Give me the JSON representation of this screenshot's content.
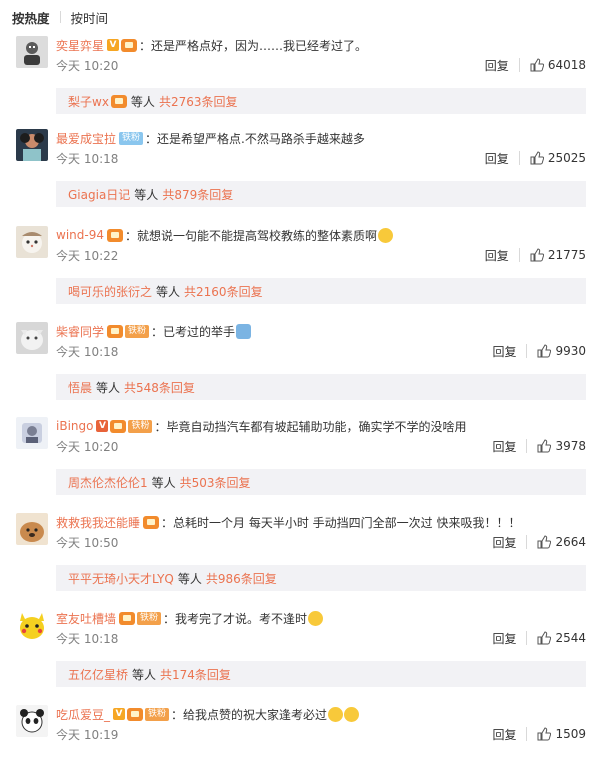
{
  "sort": {
    "hot_label": "按热度",
    "time_label": "按时间"
  },
  "labels": {
    "reply": "回复",
    "etc": "等人",
    "fan_tag": "铁粉"
  },
  "colors": {
    "username": "#eb7350",
    "subreply_bg": "#f2f2f5",
    "vip_gold": "#f6a623"
  },
  "comments": [
    {
      "user": "奕星弈星",
      "badges": [
        "v",
        "crown"
      ],
      "text": "：还是严格点好，因为……我已经考过了。",
      "time": "今天 10:20",
      "likes": "64018",
      "sub_name": "梨子wx",
      "sub_total": "共2763条回复"
    },
    {
      "user": "最爱成宝拉",
      "badges": [
        "fan-blue"
      ],
      "text": "：还是希望严格点.不然马路杀手越来越多",
      "time": "今天 10:18",
      "likes": "25025",
      "sub_name": "Giagia日记",
      "sub_total": "共879条回复"
    },
    {
      "user": "wind-94",
      "badges": [
        "crown"
      ],
      "text": "：就想说一句能不能提高驾校教练的整体素质啊",
      "emoji": [
        "crying-emoji"
      ],
      "time": "今天 10:22",
      "likes": "21775",
      "sub_name": "喝可乐的张衍之",
      "sub_total": "共2160条回复"
    },
    {
      "user": "柴睿同学",
      "badges": [
        "crown",
        "fan-orange"
      ],
      "text": "：已考过的举手",
      "emoji": [
        "raise-hand-emoji"
      ],
      "time": "今天 10:18",
      "likes": "9930",
      "sub_name": "悟晨",
      "sub_total": "共548条回复"
    },
    {
      "user": "iBingo",
      "badges": [
        "v",
        "crown",
        "fan-orange"
      ],
      "text": "：毕竟自动挡汽车都有坡起辅助功能，确实学不学的没啥用",
      "time": "今天 10:20",
      "likes": "3978",
      "sub_name": "周杰伦杰伦伦1",
      "sub_total": "共503条回复"
    },
    {
      "user": "救救我我还能睡",
      "badges": [
        "crown"
      ],
      "text": "：总耗时一个月   每天半小时   手动挡四门全部一次过   快来吸我！！！",
      "time": "今天 10:50",
      "likes": "2664",
      "sub_name": "平平无琦小天才LYQ",
      "sub_total": "共986条回复"
    },
    {
      "user": "室友吐槽墙",
      "badges": [
        "crown",
        "fan-orange"
      ],
      "text": "：我考完了才说。考不逢时",
      "emoji": [
        "laugh-emoji"
      ],
      "time": "今天 10:18",
      "likes": "2544",
      "sub_name": "五亿亿星桥",
      "sub_total": "共174条回复"
    },
    {
      "user": "吃瓜爱豆_",
      "badges": [
        "v",
        "crown",
        "fan-orange"
      ],
      "text": "：给我点赞的祝大家逢考必过",
      "emoji": [
        "kiss-emoji",
        "kiss-emoji"
      ],
      "time": "今天 10:19",
      "likes": "1509",
      "sub_name": "",
      "sub_total": ""
    }
  ]
}
